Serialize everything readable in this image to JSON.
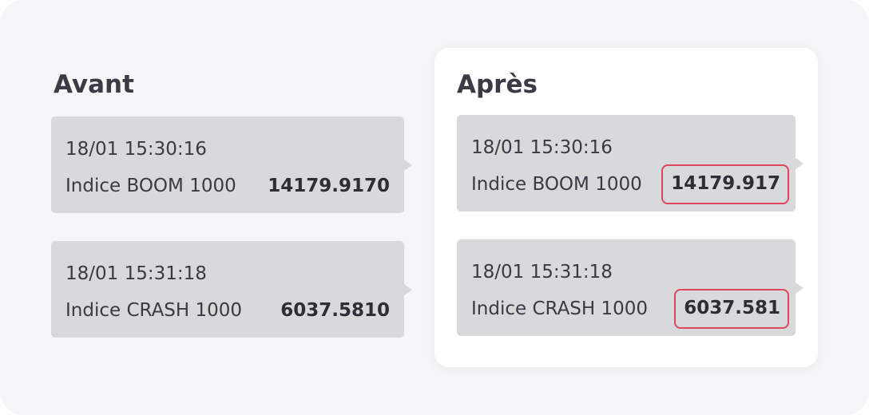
{
  "before": {
    "title": "Avant",
    "messages": [
      {
        "time": "18/01 15:30:16",
        "name": "Indice BOOM 1000",
        "value": "14179.9170"
      },
      {
        "time": "18/01 15:31:18",
        "name": "Indice CRASH 1000",
        "value": "6037.5810"
      }
    ]
  },
  "after": {
    "title": "Après",
    "messages": [
      {
        "time": "18/01 15:30:16",
        "name": "Indice BOOM 1000",
        "value": "14179.917"
      },
      {
        "time": "18/01 15:31:18",
        "name": "Indice CRASH 1000",
        "value": "6037.581"
      }
    ]
  },
  "colors": {
    "background": "#f5f6f8",
    "bubble": "#d7d9db",
    "highlight": "#e0465a"
  }
}
